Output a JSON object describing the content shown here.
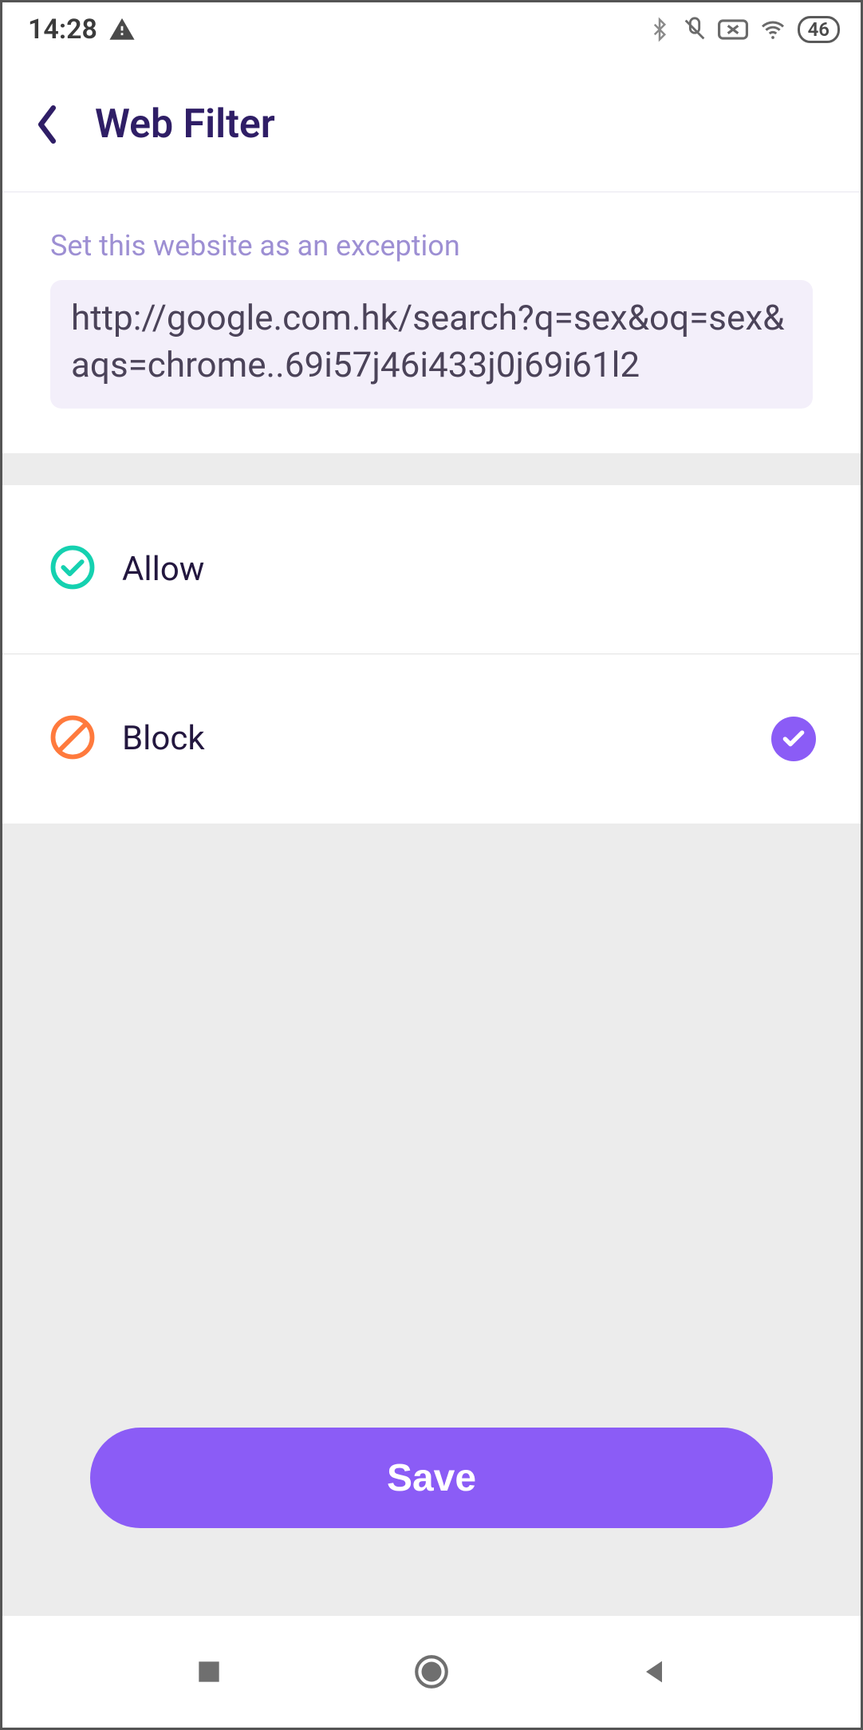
{
  "status": {
    "time": "14:28",
    "battery": "46"
  },
  "header": {
    "title": "Web Filter"
  },
  "exception": {
    "label": "Set this website as an exception",
    "url": "http://google.com.hk/search?q=sex&oq=sex&aqs=chrome..69i57j46i433j0j69i61l2"
  },
  "options": {
    "allow": {
      "label": "Allow",
      "selected": false
    },
    "block": {
      "label": "Block",
      "selected": true
    }
  },
  "actions": {
    "save": "Save"
  }
}
